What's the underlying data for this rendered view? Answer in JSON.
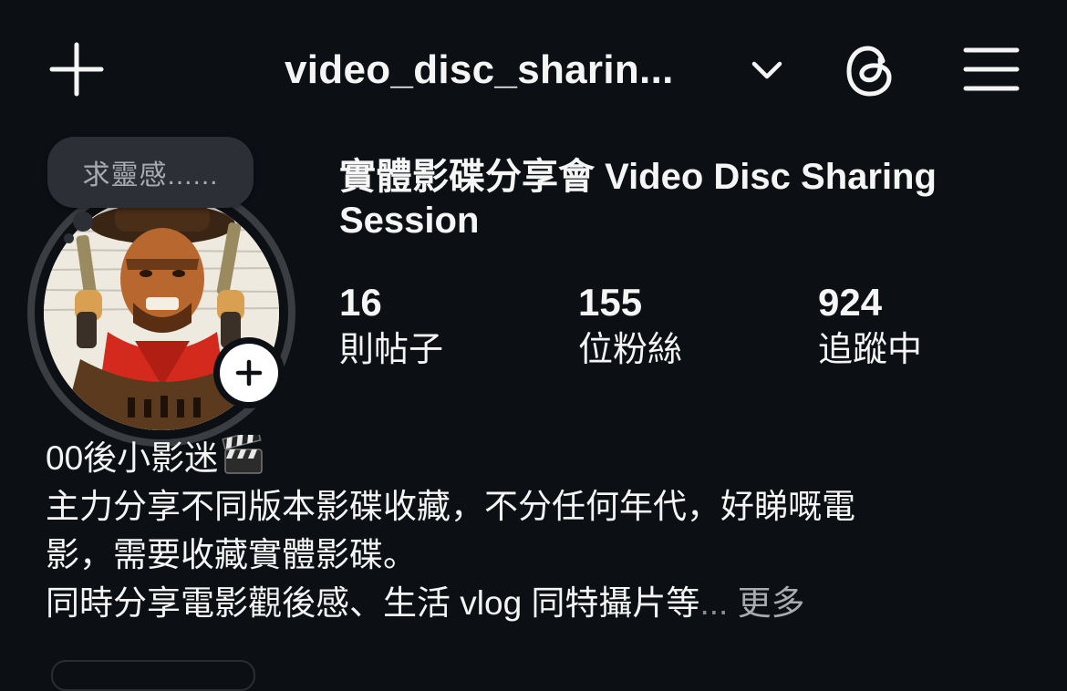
{
  "header": {
    "username": "video_disc_sharin...",
    "add_icon": "plus-icon",
    "dropdown_icon": "chevron-down-icon",
    "threads_icon": "threads-icon",
    "menu_icon": "hamburger-menu-icon"
  },
  "profile": {
    "note": "求靈感......",
    "display_name": "實體影碟分享會 Video Disc Sharing Session",
    "avatar": "profile-picture",
    "story_add_icon": "plus-icon"
  },
  "stats": {
    "posts": {
      "value": "16",
      "label": "則帖子"
    },
    "followers": {
      "value": "155",
      "label": "位粉絲"
    },
    "following": {
      "value": "924",
      "label": "追蹤中"
    }
  },
  "bio": {
    "line1": "00後小影迷",
    "line1_emoji": "clapper-board-icon",
    "line2": "主力分享不同版本影碟收藏，不分任何年代，好睇嘅電",
    "line3": "影，需要收藏實體影碟。",
    "line4": "同時分享電影觀後感、生活 vlog 同特攝片等",
    "ellipsis": "...",
    "more": "更多"
  },
  "colors": {
    "background": "#0c1014",
    "text": "#f5f5f5",
    "muted": "#a8abb0",
    "note_bubble": "#2c3036",
    "ring": "#3a3d42"
  }
}
